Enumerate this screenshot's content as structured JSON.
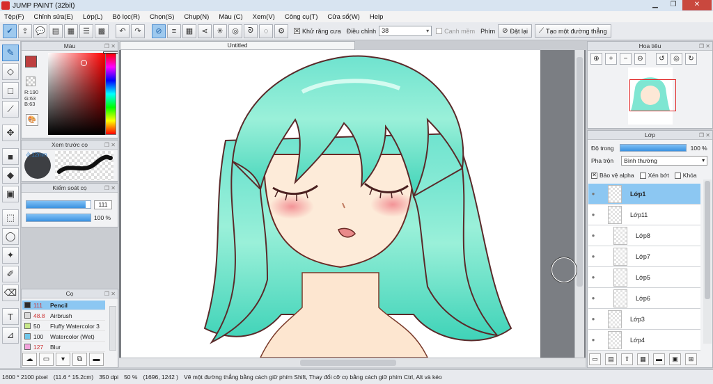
{
  "window": {
    "title": "JUMP PAINT (32bit)"
  },
  "menu": [
    "Tệp(F)",
    "Chỉnh sửa(E)",
    "Lớp(L)",
    "Bộ lọc(R)",
    "Chọn(S)",
    "Chụp(N)",
    "Màu (C)",
    "Xem(V)",
    "Công cụ(T)",
    "Cửa sổ(W)",
    "Help"
  ],
  "toolbar": {
    "antialias_label": "Khử răng cưa",
    "adjust_label": "Điều chỉnh",
    "adjust_value": "38",
    "snap_label": "Canh mềm",
    "key_label": "Phím",
    "reset_label": "Đặt lại",
    "straight_line_label": "Tạo một đường thẳng"
  },
  "panels": {
    "color": {
      "title": "Màu",
      "r": "R:190",
      "g": "G:63",
      "b": "B:63",
      "main_color": "#be3f3f",
      "secondary_color": "#bff1e7"
    },
    "brush_preview": {
      "title": "Xem trước cọ",
      "size_label": "ở.12mm"
    },
    "brush_control": {
      "title": "Kiểm soát cọ",
      "size_value": "111",
      "opacity_value": "100 %",
      "size_fraction": 0.92,
      "opacity_fraction": 1.0
    },
    "brushes": {
      "title": "Cọ",
      "items": [
        {
          "size": "111",
          "name": "Pencil",
          "color": "#2b2b2b"
        },
        {
          "size": "48.8",
          "name": "Airbrush",
          "color": "#d9d9d9"
        },
        {
          "size": "50",
          "name": "Fluffy Watercolor 3",
          "color": "#c7e88a"
        },
        {
          "size": "100",
          "name": "Watercolor (Wet)",
          "color": "#6ec6ea"
        },
        {
          "size": "127",
          "name": "Blur",
          "color": "#f2a3dc"
        }
      ]
    },
    "navigator": {
      "title": "Hoa tiêu"
    },
    "layers": {
      "title": "Lớp",
      "opacity_label": "Độ trong",
      "opacity_value": "100 %",
      "opacity_fraction": 1.0,
      "blend_label": "Pha trộn",
      "blend_value": "Bình thường",
      "protect_alpha_label": "Bảo vệ alpha",
      "clip_label": "Xén bớt",
      "lock_label": "Khóa",
      "items": [
        {
          "name": "Lớp1",
          "selected": true
        },
        {
          "name": "Lớp11"
        },
        {
          "name": "Lớp8",
          "indent": true
        },
        {
          "name": "Lớp7",
          "indent": true
        },
        {
          "name": "Lớp5",
          "indent": true
        },
        {
          "name": "Lớp6",
          "indent": true
        },
        {
          "name": "Lớp3"
        },
        {
          "name": "Lớp4"
        }
      ]
    }
  },
  "document": {
    "tab_title": "Untitled"
  },
  "status": {
    "pixel_size": "1600 * 2100 pixel",
    "physical_size": "(11.6 * 15.2cm)",
    "dpi": "350 dpi",
    "zoom": "50 %",
    "coords": "(1696, 1242 )",
    "hint": "Vẽ một đường thẳng bằng cách giữ phím Shift, Thay đổi cỡ cọ bằng cách giữ phím Ctrl, Alt và kéo"
  }
}
